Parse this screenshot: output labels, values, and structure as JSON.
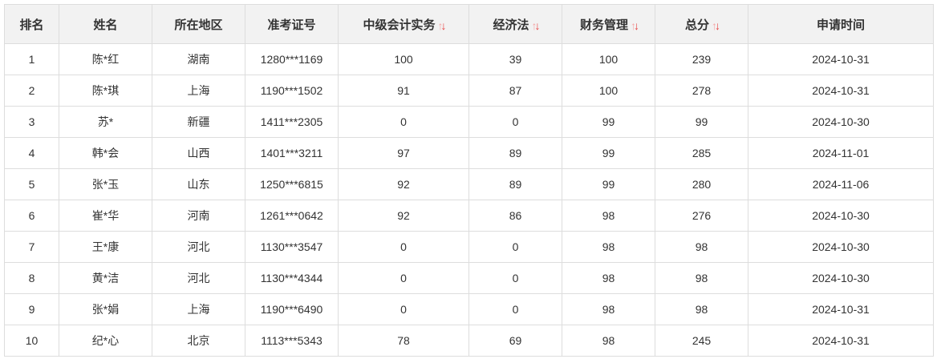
{
  "headers": [
    {
      "label": "排名",
      "sortable": false
    },
    {
      "label": "姓名",
      "sortable": false
    },
    {
      "label": "所在地区",
      "sortable": false
    },
    {
      "label": "准考证号",
      "sortable": false
    },
    {
      "label": "中级会计实务",
      "sortable": true
    },
    {
      "label": "经济法",
      "sortable": true
    },
    {
      "label": "财务管理",
      "sortable": true
    },
    {
      "label": "总分",
      "sortable": true
    },
    {
      "label": "申请时间",
      "sortable": false
    }
  ],
  "sort_icon": {
    "name": "sort-arrows-icon",
    "up_color": "#f5a8a8",
    "down_color": "#e84545"
  },
  "rows": [
    [
      "1",
      "陈*红",
      "湖南",
      "1280***1169",
      "100",
      "39",
      "100",
      "239",
      "2024-10-31"
    ],
    [
      "2",
      "陈*琪",
      "上海",
      "1190***1502",
      "91",
      "87",
      "100",
      "278",
      "2024-10-31"
    ],
    [
      "3",
      "苏*",
      "新疆",
      "1411***2305",
      "0",
      "0",
      "99",
      "99",
      "2024-10-30"
    ],
    [
      "4",
      "韩*会",
      "山西",
      "1401***3211",
      "97",
      "89",
      "99",
      "285",
      "2024-11-01"
    ],
    [
      "5",
      "张*玉",
      "山东",
      "1250***6815",
      "92",
      "89",
      "99",
      "280",
      "2024-11-06"
    ],
    [
      "6",
      "崔*华",
      "河南",
      "1261***0642",
      "92",
      "86",
      "98",
      "276",
      "2024-10-30"
    ],
    [
      "7",
      "王*康",
      "河北",
      "1130***3547",
      "0",
      "0",
      "98",
      "98",
      "2024-10-30"
    ],
    [
      "8",
      "黄*洁",
      "河北",
      "1130***4344",
      "0",
      "0",
      "98",
      "98",
      "2024-10-30"
    ],
    [
      "9",
      "张*娟",
      "上海",
      "1190***6490",
      "0",
      "0",
      "98",
      "98",
      "2024-10-31"
    ],
    [
      "10",
      "纪*心",
      "北京",
      "1113***5343",
      "78",
      "69",
      "98",
      "245",
      "2024-10-31"
    ]
  ]
}
